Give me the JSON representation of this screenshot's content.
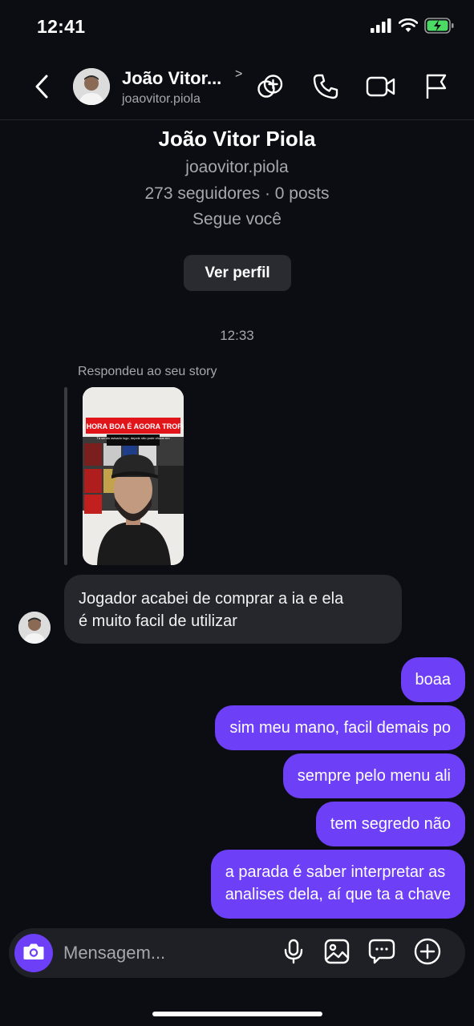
{
  "status_bar": {
    "time": "12:41"
  },
  "header": {
    "display_name": "João Vitor...",
    "chevron": ">",
    "username": "joaovitor.piola"
  },
  "profile": {
    "name": "João Vitor Piola",
    "username": "joaovitor.piola",
    "stats": "273 seguidores · 0 posts",
    "follows_you": "Segue você",
    "view_profile_label": "Ver perfil"
  },
  "chat": {
    "timestamp": "12:33",
    "story_reply_label": "Respondeu ao seu story",
    "story": {
      "banner": "A HORA BOA É AGORA TROPA",
      "caption": "Tá sendo avisado logo, depois não pode chorar em"
    },
    "incoming": [
      {
        "line1": "Jogador acabei de comprar a ia e ela",
        "line2": "é muito facil de utilizar"
      }
    ],
    "outgoing": [
      {
        "text": "boaa"
      },
      {
        "text": "sim meu mano, facil demais po"
      },
      {
        "text": "sempre pelo menu ali"
      },
      {
        "text": "tem segredo não"
      },
      {
        "line1": "a parada é saber interpretar as",
        "line2": "analises dela, aí que ta a chave"
      }
    ]
  },
  "composer": {
    "placeholder": "Mensagem..."
  },
  "colors": {
    "background": "#0c0d13",
    "outgoing_bubble": "#6d3ff6",
    "incoming_bubble": "#26272d",
    "muted_text": "#a6a7ad",
    "battery_charging": "#4cd964"
  },
  "icons": {
    "status": [
      "signal-icon",
      "wifi-icon",
      "battery-charging-icon"
    ],
    "header": [
      "back-chevron-icon",
      "add-people-icon",
      "phone-icon",
      "video-camera-icon",
      "flag-icon"
    ],
    "composer": [
      "camera-icon",
      "microphone-icon",
      "image-icon",
      "sticker-chat-icon",
      "plus-circle-icon"
    ]
  }
}
